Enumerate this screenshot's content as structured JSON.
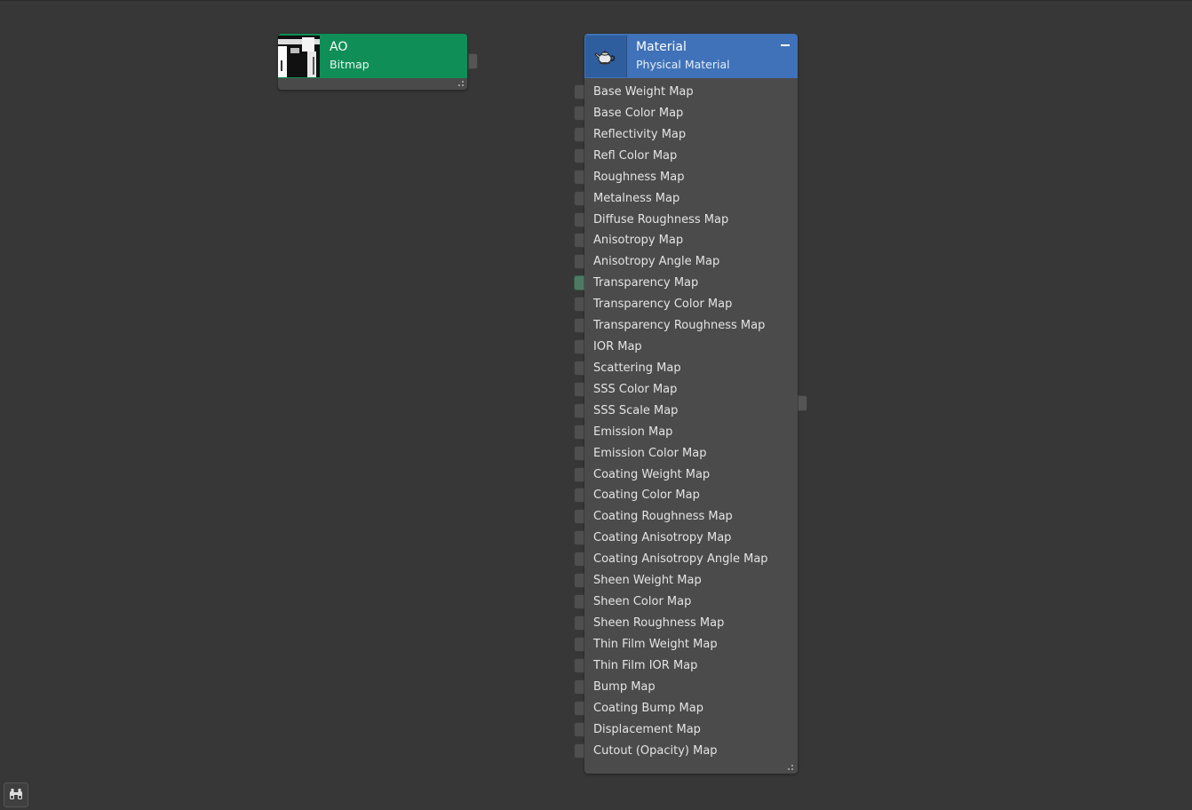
{
  "nodes": {
    "ao": {
      "title": "AO",
      "subtitle": "Bitmap",
      "header_color": "#0f8f57",
      "thumbnail_icon": "bitmap-thumbnail"
    },
    "material": {
      "title": "Material",
      "subtitle": "Physical Material",
      "header_color": "#3f72b8",
      "icon": "teapot-icon",
      "collapse_icon": "minus-icon",
      "slots": [
        {
          "label": "Base Weight Map",
          "connected": false
        },
        {
          "label": "Base Color Map",
          "connected": false
        },
        {
          "label": "Reflectivity Map",
          "connected": false
        },
        {
          "label": "Refl Color Map",
          "connected": false
        },
        {
          "label": "Roughness Map",
          "connected": false
        },
        {
          "label": "Metalness Map",
          "connected": false
        },
        {
          "label": "Diffuse Roughness Map",
          "connected": false
        },
        {
          "label": "Anisotropy Map",
          "connected": false
        },
        {
          "label": "Anisotropy Angle Map",
          "connected": false
        },
        {
          "label": "Transparency Map",
          "connected": true
        },
        {
          "label": "Transparency Color Map",
          "connected": false
        },
        {
          "label": "Transparency Roughness Map",
          "connected": false
        },
        {
          "label": "IOR Map",
          "connected": false
        },
        {
          "label": "Scattering Map",
          "connected": false
        },
        {
          "label": "SSS Color Map",
          "connected": false
        },
        {
          "label": "SSS Scale Map",
          "connected": false
        },
        {
          "label": "Emission Map",
          "connected": false
        },
        {
          "label": "Emission Color Map",
          "connected": false
        },
        {
          "label": "Coating Weight Map",
          "connected": false
        },
        {
          "label": "Coating Color Map",
          "connected": false
        },
        {
          "label": "Coating Roughness Map",
          "connected": false
        },
        {
          "label": "Coating Anisotropy Map",
          "connected": false
        },
        {
          "label": "Coating Anisotropy Angle Map",
          "connected": false
        },
        {
          "label": "Sheen Weight Map",
          "connected": false
        },
        {
          "label": "Sheen Color Map",
          "connected": false
        },
        {
          "label": "Sheen Roughness Map",
          "connected": false
        },
        {
          "label": "Thin Film Weight Map",
          "connected": false
        },
        {
          "label": "Thin Film IOR Map",
          "connected": false
        },
        {
          "label": "Bump Map",
          "connected": false
        },
        {
          "label": "Coating Bump Map",
          "connected": false
        },
        {
          "label": "Displacement Map",
          "connected": false
        },
        {
          "label": "Cutout (Opacity) Map",
          "connected": false
        }
      ]
    }
  },
  "toolbar": {
    "find_icon": "binoculars-icon"
  },
  "colors": {
    "canvas_bg": "#373737",
    "node_body": "#4b4b4b",
    "port_connected": "#4e7a64"
  }
}
